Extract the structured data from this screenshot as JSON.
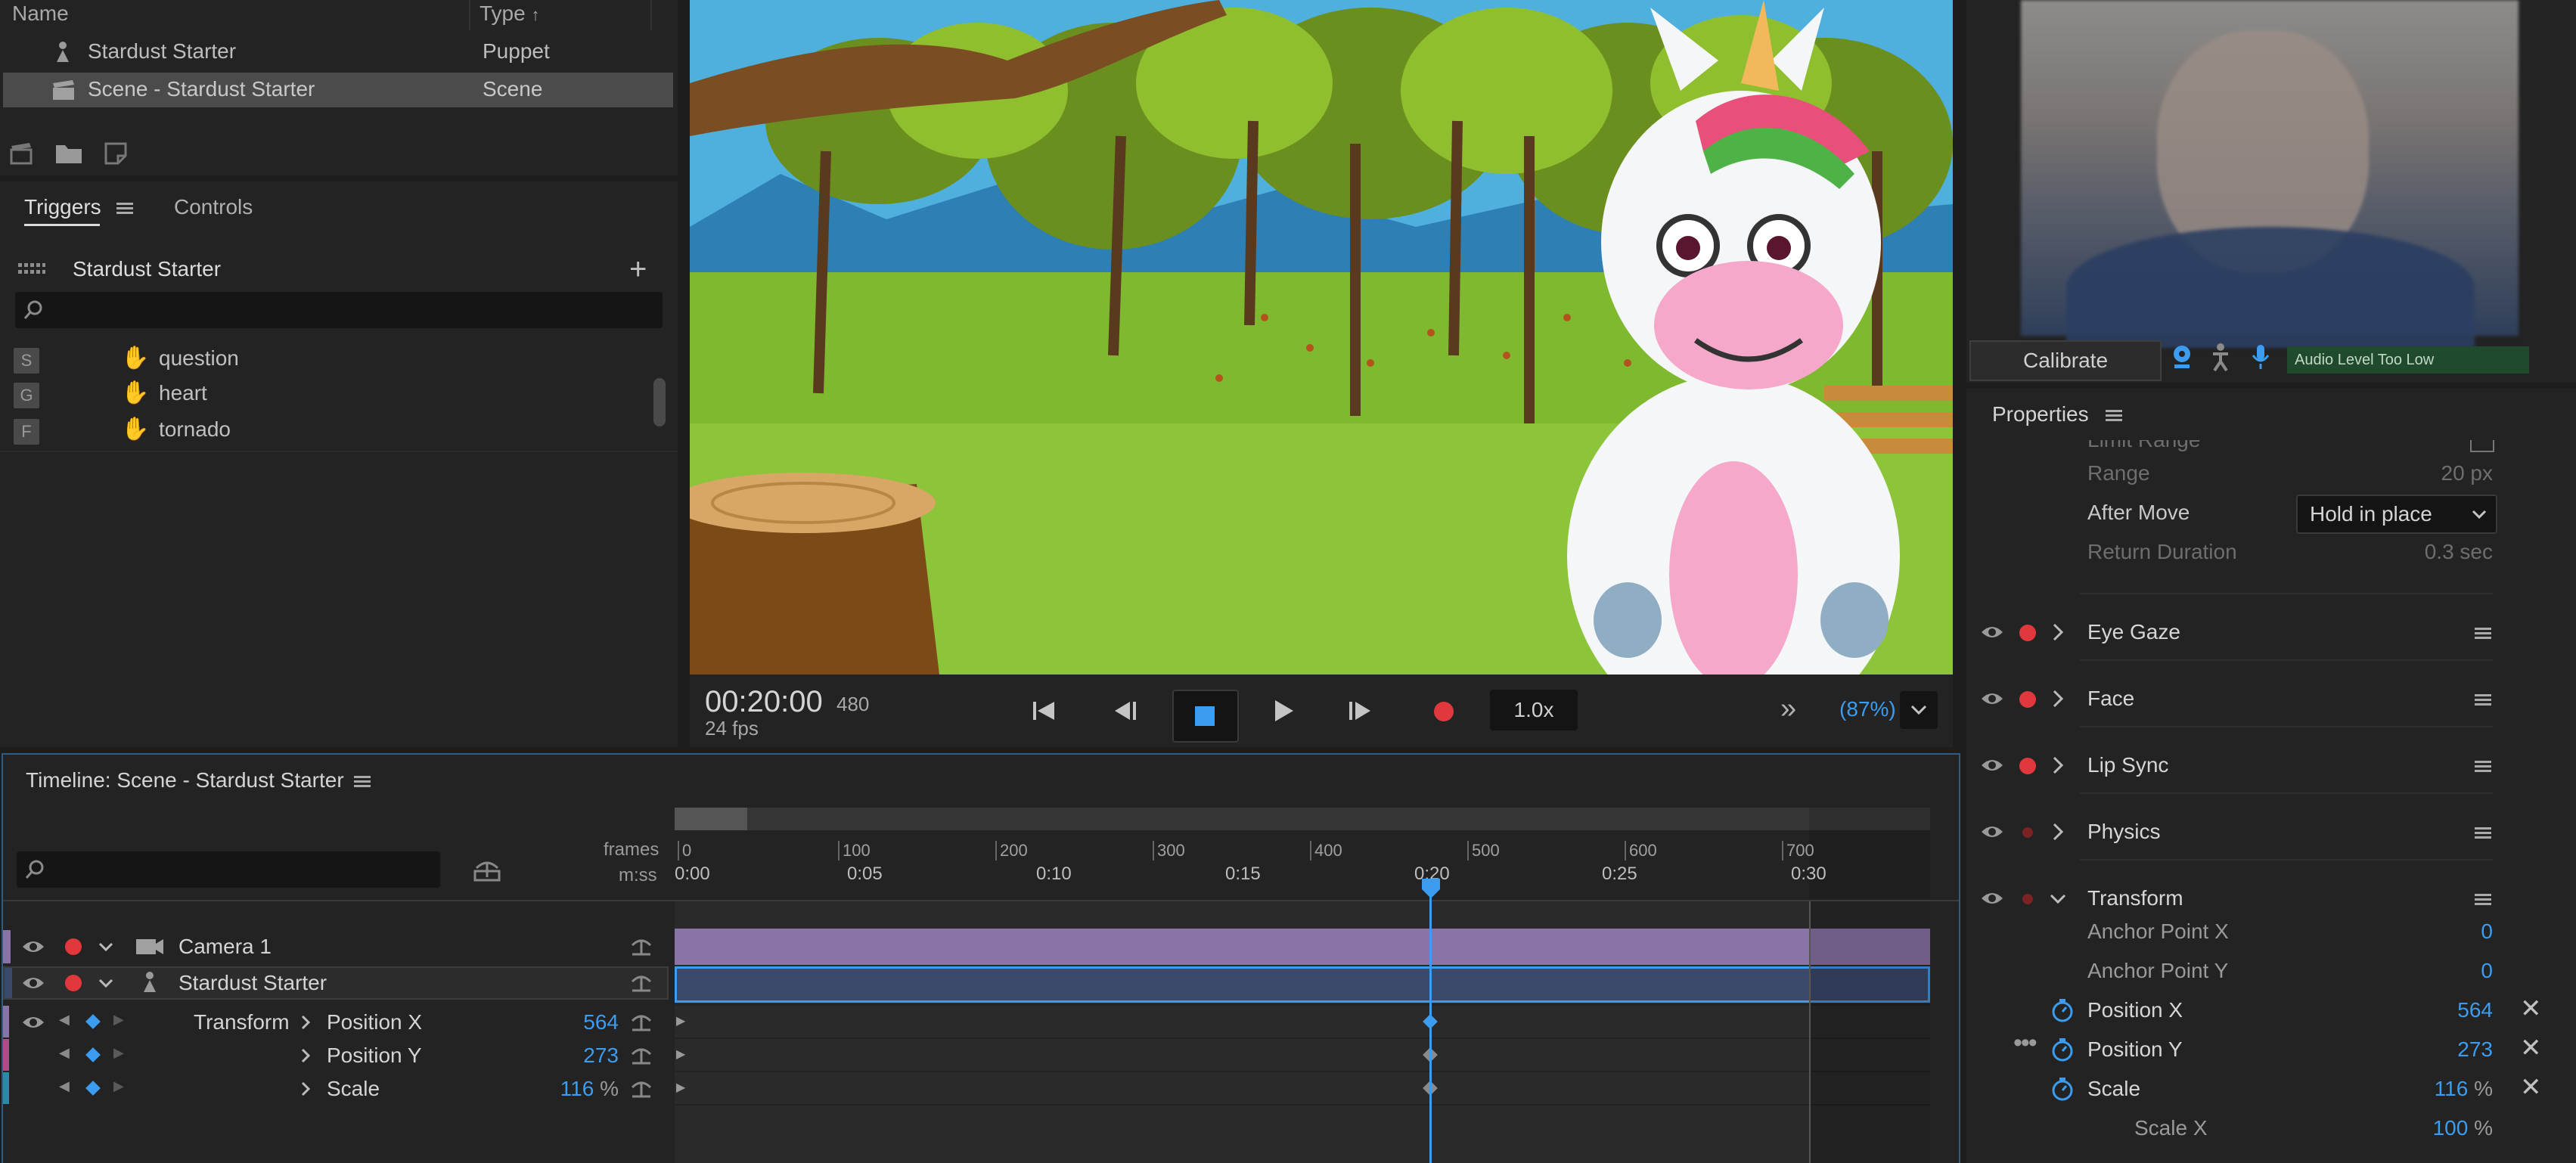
{
  "project": {
    "col_name": "Name",
    "col_type": "Type",
    "items": [
      {
        "name": "Stardust Starter",
        "type": "Puppet"
      },
      {
        "name": "Scene - Stardust Starter",
        "type": "Scene"
      }
    ]
  },
  "triggers": {
    "tab_triggers": "Triggers",
    "tab_controls": "Controls",
    "puppet_name": "Stardust Starter",
    "items": [
      {
        "key": "S",
        "label": "question"
      },
      {
        "key": "G",
        "label": "heart"
      },
      {
        "key": "F",
        "label": "tornado"
      }
    ]
  },
  "transport": {
    "timecode": "00:20:00",
    "frame": "480",
    "fps": "24 fps",
    "speed": "1.0x",
    "zoom": "(87%)"
  },
  "camera": {
    "calibrate": "Calibrate",
    "audio_status": "Audio Level Too Low"
  },
  "properties": {
    "title": "Properties",
    "partial_label": "Limit Range",
    "range_label": "Range",
    "range_value": "20 px",
    "after_move_label": "After Move",
    "after_move_value": "Hold in place",
    "return_label": "Return Duration",
    "return_value": "0.3 sec",
    "groups": [
      "Eye Gaze",
      "Face",
      "Lip Sync",
      "Physics",
      "Transform"
    ],
    "transform": [
      {
        "label": "Anchor Point X",
        "value": "0",
        "unit": ""
      },
      {
        "label": "Anchor Point Y",
        "value": "0",
        "unit": ""
      },
      {
        "label": "Position X",
        "value": "564",
        "unit": ""
      },
      {
        "label": "Position Y",
        "value": "273",
        "unit": ""
      },
      {
        "label": "Scale",
        "value": "116",
        "unit": "%"
      },
      {
        "label": "Scale X",
        "value": "100",
        "unit": "%"
      }
    ]
  },
  "timeline": {
    "title": "Timeline: Scene - Stardust Starter",
    "frames_label": "frames",
    "mss_label": "m:ss",
    "frame_ticks": [
      "0",
      "100",
      "200",
      "300",
      "400",
      "500",
      "600",
      "700"
    ],
    "time_ticks": [
      "0:00",
      "0:05",
      "0:10",
      "0:15",
      "0:20",
      "0:25",
      "0:30"
    ],
    "camera_track": "Camera 1",
    "puppet_track": "Stardust Starter",
    "transform_label": "Transform",
    "params": [
      {
        "label": "Position X",
        "value": "564",
        "unit": ""
      },
      {
        "label": "Position Y",
        "value": "273",
        "unit": ""
      },
      {
        "label": "Scale",
        "value": "116",
        "unit": "%"
      }
    ]
  },
  "colors": {
    "accent": "#3b9cf0",
    "record": "#e0383c",
    "camera_track": "#8a73a6",
    "puppet_track": "#3b4a6b"
  }
}
